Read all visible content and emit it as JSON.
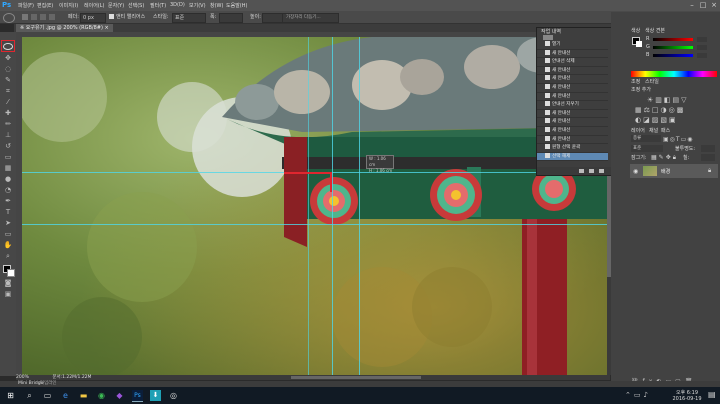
{
  "app": {
    "logo": "Ps"
  },
  "menu": [
    "파일(F)",
    "편집(E)",
    "이미지(I)",
    "레이어(L)",
    "문자(Y)",
    "선택(S)",
    "필터(T)",
    "3D(D)",
    "보기(V)",
    "창(W)",
    "도움말(H)"
  ],
  "window_controls": [
    "–",
    "□",
    "×"
  ],
  "options": {
    "feather_label": "페더:",
    "feather_value": "0 px",
    "antialias_label": "앤티 앨리어스",
    "style_label": "스타일:",
    "style_value": "표준",
    "width_label": "폭:",
    "height_label": "높이:",
    "refine_button": "가장자리 다듬기...",
    "workspace": "필수"
  },
  "doc_tab": {
    "title": "※ 요구유기 .jpg @ 200% (RGB/8#) ×"
  },
  "history_panel": {
    "tabs": [
      "작업 내역",
      "속성"
    ],
    "items": [
      "열기",
      "새 안내선",
      "안내선 삭제",
      "새 안내선",
      "새 안내선",
      "새 안내선",
      "새 안내선",
      "안내선 지우기",
      "새 안내선",
      "새 안내선",
      "새 안내선",
      "새 안내선",
      "원형 선택 윤곽",
      "선택 해제"
    ],
    "active_index": 13
  },
  "measure_tooltip": {
    "w": "W : 1.06 cm",
    "h": "H : 1.06 cm"
  },
  "status": {
    "zoom": "200%",
    "doc": "문서:1.22M/1.22M",
    "mini_bridge": "Mini Bridge",
    "timeline": "타임라인"
  },
  "color_panel": {
    "tabs": [
      "색상",
      "색상 견본"
    ],
    "labels": [
      "R",
      "G",
      "B"
    ]
  },
  "adjust_panel": {
    "tabs": [
      "조정",
      "스타일"
    ],
    "title": "조정 추가"
  },
  "layers_panel": {
    "tabs": [
      "레이어",
      "채널",
      "패스"
    ],
    "kind": "종류",
    "blend": "표준",
    "opacity_label": "불투명도:",
    "fill_label": "칠:",
    "lock_label": "잠그기:",
    "layer_name": "배경"
  },
  "taskbar": {
    "time": "오후 6:19",
    "date": "2016-09-19"
  },
  "colors": {
    "accent": "#31a8ff",
    "guide": "#4fd7e8",
    "selection": "#e0262f",
    "history_active": "#5e89b4"
  }
}
